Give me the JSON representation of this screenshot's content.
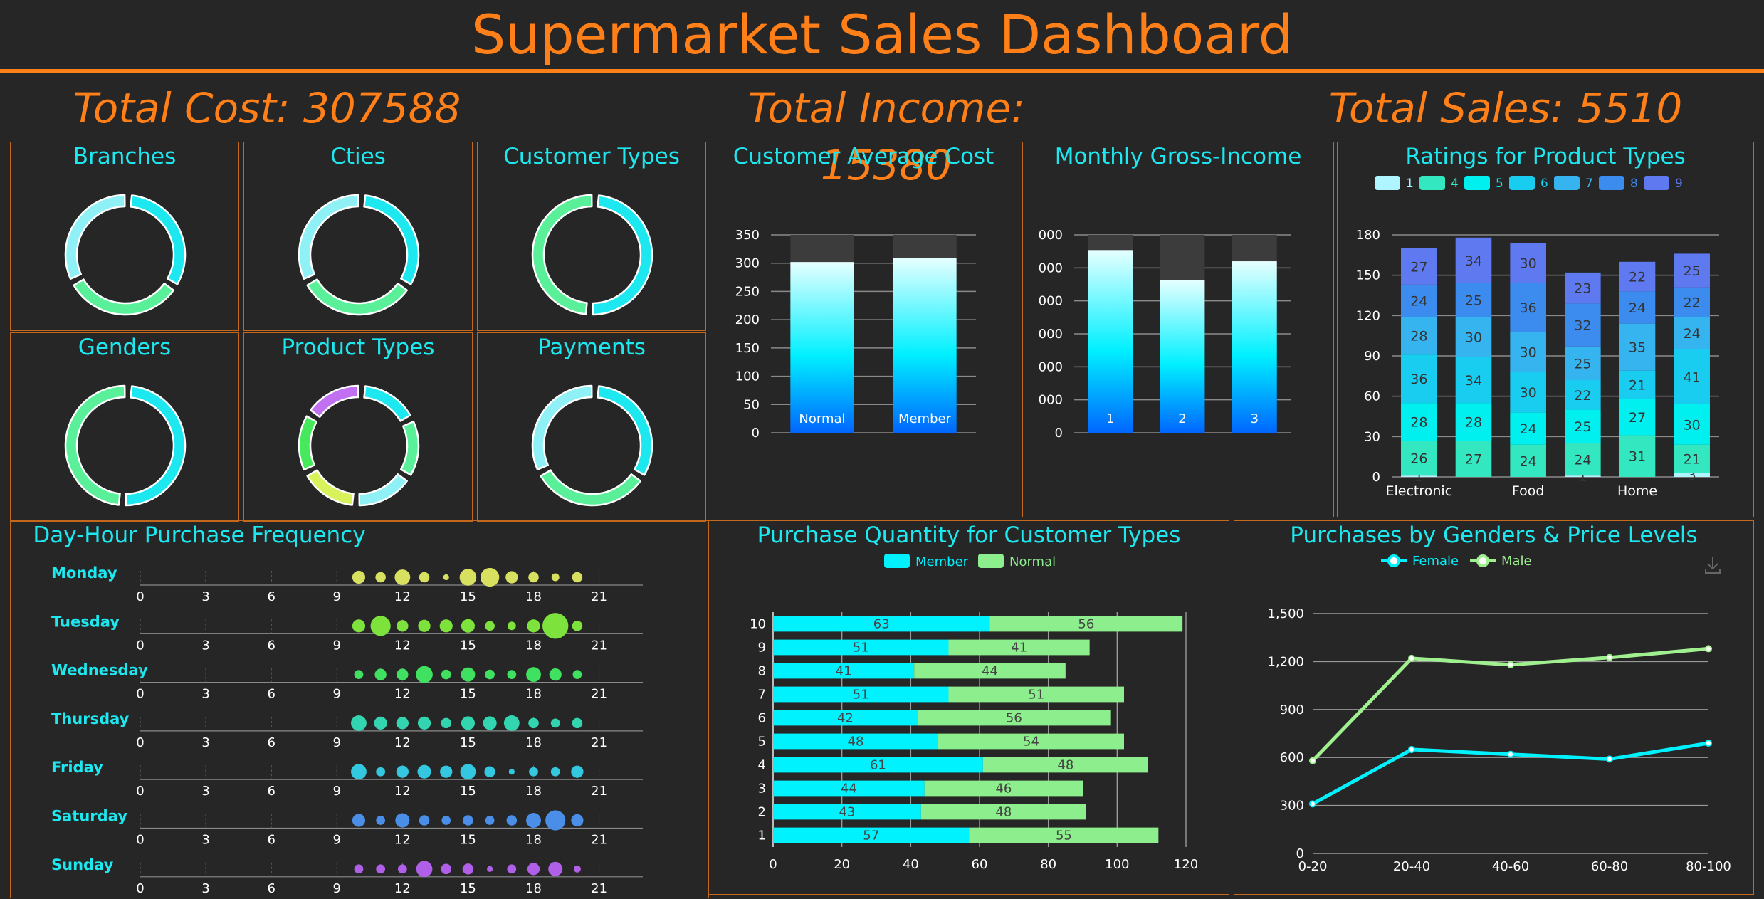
{
  "header": {
    "title": "Supermarket Sales Dashboard"
  },
  "kpis": {
    "total_cost": "Total Cost: 307588",
    "total_income": "Total Income: 15380",
    "total_sales": "Total Sales: 5510"
  },
  "colors": {
    "accent": "#ff7f18",
    "panel_title": "#1de8f0",
    "panel_border": "#c4681b",
    "background": "#262626"
  },
  "chart_data": [
    {
      "type": "pie",
      "title": "Branches",
      "variant": "donut",
      "categories": [
        "",
        "",
        ""
      ],
      "values": [
        1,
        1,
        1
      ],
      "colors": [
        "#1de8f0",
        "#5af09a",
        "#8ff0f5"
      ]
    },
    {
      "type": "pie",
      "title": "Cties",
      "variant": "donut",
      "categories": [
        "",
        "",
        ""
      ],
      "values": [
        1,
        1,
        1
      ],
      "colors": [
        "#1de8f0",
        "#5af09a",
        "#8ff0f5"
      ]
    },
    {
      "type": "pie",
      "title": "Customer Types",
      "variant": "donut",
      "categories": [
        "",
        ""
      ],
      "values": [
        1,
        1
      ],
      "colors": [
        "#1de8f0",
        "#5af09a"
      ]
    },
    {
      "type": "pie",
      "title": "Genders",
      "variant": "donut",
      "categories": [
        "",
        ""
      ],
      "values": [
        1,
        1
      ],
      "colors": [
        "#1de8f0",
        "#5af09a"
      ]
    },
    {
      "type": "pie",
      "title": "Product Types",
      "variant": "donut",
      "categories": [
        "",
        "",
        "",
        "",
        "",
        ""
      ],
      "values": [
        1,
        1,
        1,
        1,
        1,
        1
      ],
      "colors": [
        "#1de8f0",
        "#5af09a",
        "#8ff0f5",
        "#d7f25a",
        "#46e85c",
        "#c070f0"
      ]
    },
    {
      "type": "pie",
      "title": "Payments",
      "variant": "donut",
      "categories": [
        "",
        "",
        ""
      ],
      "values": [
        1,
        1,
        1
      ],
      "colors": [
        "#1de8f0",
        "#5af09a",
        "#8ff0f5"
      ]
    },
    {
      "type": "bar",
      "title": "Customer Average Cost",
      "categories": [
        "Normal",
        "Member"
      ],
      "values": [
        302,
        309
      ],
      "background_max": 350,
      "yticks": [
        "350",
        "300",
        "250",
        "200",
        "150",
        "100",
        "50",
        "0"
      ],
      "ylim": [
        0,
        350
      ]
    },
    {
      "type": "bar",
      "title": "Monthly Gross-Income",
      "categories": [
        "1",
        "2",
        "3"
      ],
      "values": [
        5540,
        4630,
        5200
      ],
      "background_max": 6000,
      "yticks": [
        "000",
        "000",
        "000",
        "000",
        "000",
        "000",
        "0"
      ],
      "ylim": [
        0,
        6000
      ]
    },
    {
      "type": "bar",
      "stacked": true,
      "title": "Ratings for Product Types",
      "legend": [
        "1",
        "4",
        "5",
        "6",
        "7",
        "8",
        "9"
      ],
      "categories": [
        "Electronic",
        "",
        "Food",
        "",
        "Home",
        ""
      ],
      "xticklabels": [
        "Electronic",
        "Food",
        "Home"
      ],
      "ylim": [
        0,
        180
      ],
      "yticks": [
        "180",
        "150",
        "120",
        "90",
        "60",
        "30",
        "0"
      ],
      "series": [
        {
          "name": "1",
          "values": [
            1,
            0,
            0,
            1,
            0,
            3
          ]
        },
        {
          "name": "4",
          "values": [
            26,
            27,
            24,
            24,
            31,
            21
          ]
        },
        {
          "name": "5",
          "values": [
            28,
            28,
            24,
            25,
            27,
            30
          ]
        },
        {
          "name": "6",
          "values": [
            36,
            34,
            30,
            22,
            21,
            41
          ]
        },
        {
          "name": "7",
          "values": [
            28,
            30,
            30,
            25,
            35,
            24
          ]
        },
        {
          "name": "8",
          "values": [
            24,
            25,
            36,
            32,
            24,
            22
          ]
        },
        {
          "name": "9",
          "values": [
            27,
            34,
            30,
            23,
            22,
            25
          ]
        }
      ],
      "colors": [
        "#aef5ff",
        "#33e8c0",
        "#00f0f0",
        "#19cdf0",
        "#35b4f0",
        "#3c8cf0",
        "#5f7af0"
      ]
    },
    {
      "type": "scatter",
      "title": "Day-Hour Purchase Frequency",
      "rows": [
        "Monday",
        "Tuesday",
        "Wednesday",
        "Thursday",
        "Friday",
        "Saturday",
        "Sunday"
      ],
      "xticks": [
        "0",
        "3",
        "6",
        "9",
        "12",
        "15",
        "18",
        "21"
      ],
      "xlim": [
        0,
        23
      ],
      "hours": [
        10,
        11,
        12,
        13,
        14,
        15,
        16,
        17,
        18,
        19,
        20
      ],
      "values": [
        [
          20,
          16,
          24,
          16,
          9,
          26,
          29,
          19,
          16,
          12,
          16
        ],
        [
          20,
          31,
          18,
          19,
          20,
          21,
          15,
          13,
          20,
          40,
          16
        ],
        [
          14,
          18,
          18,
          26,
          15,
          22,
          15,
          14,
          23,
          19,
          14
        ],
        [
          24,
          20,
          19,
          20,
          16,
          21,
          21,
          24,
          16,
          14,
          16
        ],
        [
          24,
          14,
          19,
          21,
          19,
          24,
          17,
          9,
          14,
          14,
          19
        ],
        [
          20,
          14,
          22,
          16,
          14,
          16,
          14,
          16,
          23,
          31,
          19
        ],
        [
          14,
          14,
          14,
          25,
          16,
          17,
          9,
          14,
          19,
          22,
          11
        ]
      ],
      "colors": [
        "#d8e060",
        "#7ee23c",
        "#40e060",
        "#33d4b0",
        "#33c8e0",
        "#4a8ee8",
        "#b060e8"
      ]
    },
    {
      "type": "bar",
      "stacked": true,
      "orientation": "horizontal",
      "title": "Purchase Quantity for Customer Types",
      "legend": [
        "Member",
        "Normal"
      ],
      "categories": [
        "1",
        "2",
        "3",
        "4",
        "5",
        "6",
        "7",
        "8",
        "9",
        "10"
      ],
      "series": [
        {
          "name": "Member",
          "values": [
            57,
            43,
            44,
            61,
            48,
            42,
            51,
            41,
            51,
            63
          ]
        },
        {
          "name": "Normal",
          "values": [
            55,
            48,
            46,
            48,
            54,
            56,
            51,
            44,
            41,
            56
          ]
        }
      ],
      "xlim": [
        0,
        120
      ],
      "xticks": [
        "0",
        "20",
        "40",
        "60",
        "80",
        "100",
        "120"
      ],
      "colors": [
        "#00f2ff",
        "#8cee8c"
      ]
    },
    {
      "type": "line",
      "title": "Purchases by Genders & Price Levels",
      "legend": [
        "Female",
        "Male"
      ],
      "categories": [
        "0-20",
        "20-40",
        "40-60",
        "60-80",
        "80-100"
      ],
      "series": [
        {
          "name": "Female",
          "values": [
            310,
            650,
            620,
            590,
            690
          ]
        },
        {
          "name": "Male",
          "values": [
            580,
            1220,
            1180,
            1225,
            1280
          ]
        }
      ],
      "ylim": [
        0,
        1500
      ],
      "yticks": [
        "0",
        "300",
        "600",
        "900",
        "1,200",
        "1,500"
      ],
      "colors": [
        "#00f2ff",
        "#a0f090"
      ]
    }
  ]
}
